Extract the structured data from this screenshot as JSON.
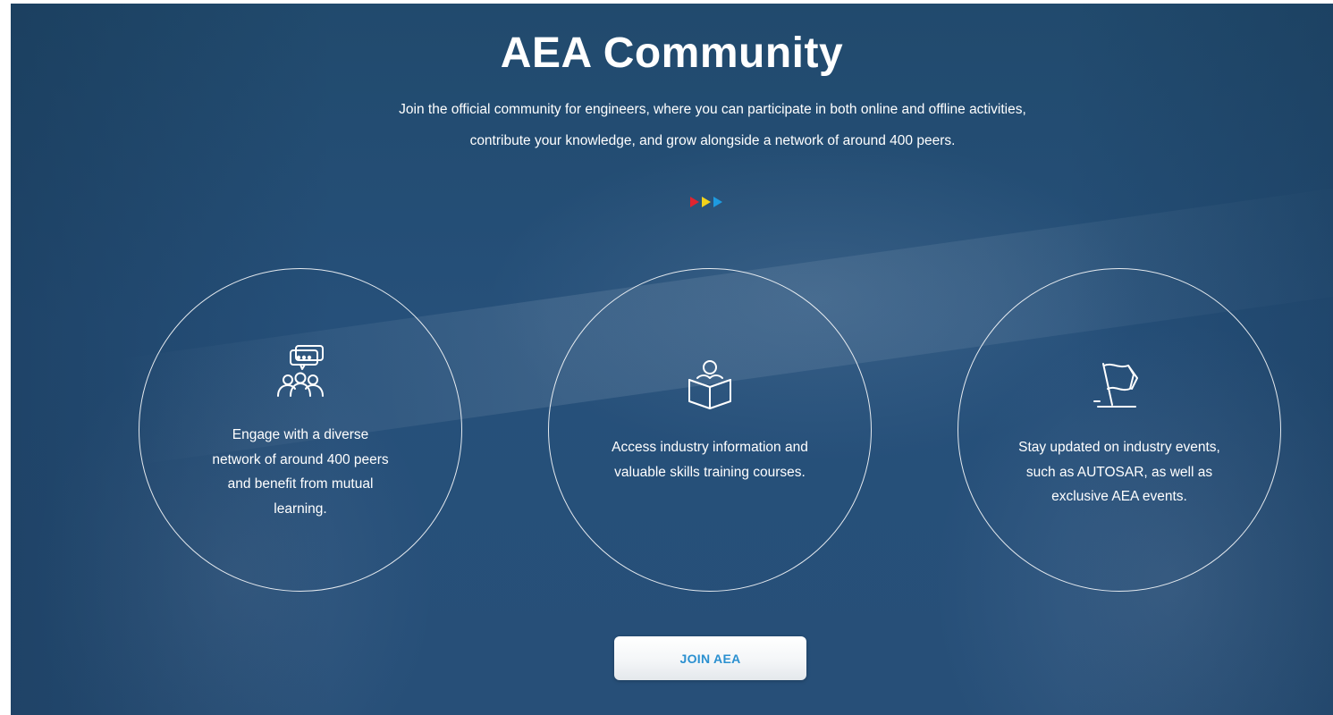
{
  "header": {
    "title": "AEA Community",
    "intro_line_1": "Join the official community for engineers, where you can participate in both online and offline activities,",
    "intro_line_2": "contribute your knowledge, and grow alongside a network of around 400 peers."
  },
  "divider": {
    "arrow_colors": [
      "#e0242f",
      "#f2d21b",
      "#1e9be0"
    ]
  },
  "features": [
    {
      "icon": "community-chat-icon",
      "text": "Engage with a diverse network of around 400 peers and benefit from mutual learning."
    },
    {
      "icon": "reading-person-icon",
      "text": "Access industry information and valuable skills training courses."
    },
    {
      "icon": "flag-icon",
      "text": "Stay updated on industry events, such as AUTOSAR, as well as exclusive AEA events."
    }
  ],
  "cta": {
    "join_label": "JOIN AEA"
  },
  "colors": {
    "background": "#26507a",
    "text": "#ffffff",
    "button_text": "#2a90d0"
  }
}
